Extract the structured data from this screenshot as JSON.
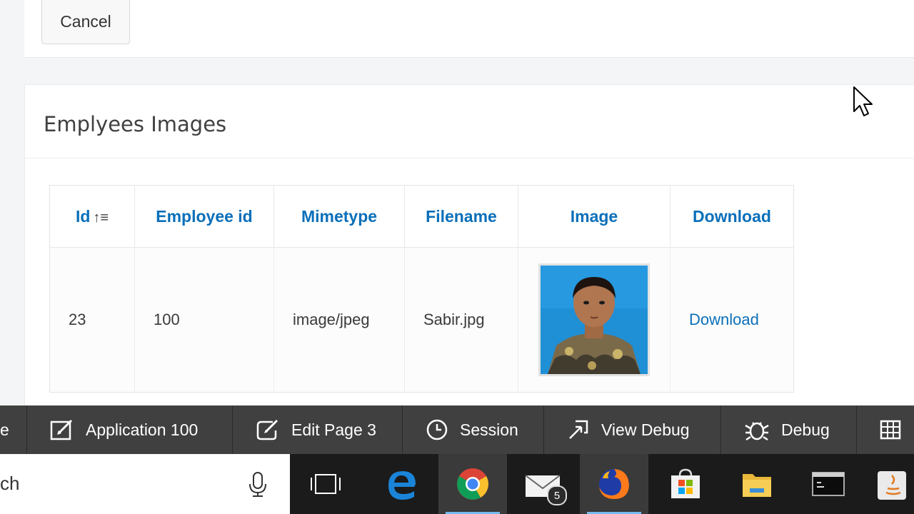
{
  "top": {
    "cancel_label": "Cancel"
  },
  "region": {
    "title": "Emplyees Images",
    "columns": [
      "Id",
      "Employee id",
      "Mimetype",
      "Filename",
      "Image",
      "Download"
    ],
    "rows": [
      {
        "id": "23",
        "employee_id": "100",
        "mimetype": "image/jpeg",
        "filename": "Sabir.jpg",
        "download": "Download"
      }
    ]
  },
  "devbar": {
    "items": [
      "e",
      "Application 100",
      "Edit Page 3",
      "Session",
      "View Debug",
      "Debug"
    ]
  },
  "taskbar": {
    "search_text": "ch",
    "mail_badge": "5"
  },
  "colors": {
    "link": "#0b6fb9",
    "devbar_bg": "#404040",
    "taskbar_bg": "#1b1b1b"
  }
}
